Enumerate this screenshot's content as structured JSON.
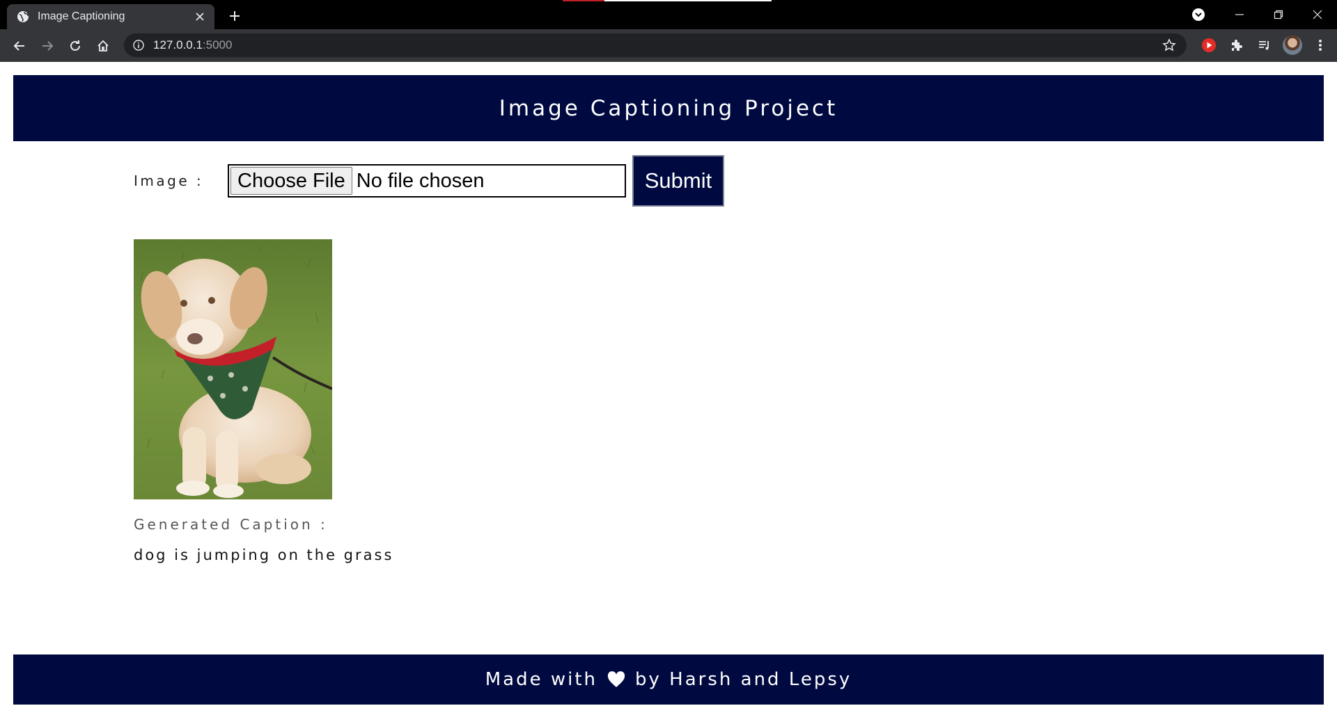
{
  "browser": {
    "tab_title": "Image Captioning",
    "url_host": "127.0.0.1",
    "url_port": ":5000"
  },
  "page": {
    "header_title": "Image Captioning Project",
    "image_label": "Image :",
    "file_button_label": "Choose File",
    "file_status": "No file chosen",
    "submit_label": "Submit",
    "caption_label": "Generated Caption :",
    "caption_text": "dog is jumping on the grass",
    "footer_prefix": "Made with",
    "footer_suffix": "by Harsh and Lepsy"
  },
  "colors": {
    "brand_navy": "#000a40",
    "chrome_dark": "#35363a"
  },
  "icons": [
    "globe-icon",
    "close-icon",
    "plus-icon",
    "back-arrow-icon",
    "forward-arrow-icon",
    "reload-icon",
    "home-icon",
    "info-icon",
    "star-icon",
    "youtube-icon",
    "puzzle-icon",
    "media-queue-icon",
    "kebab-menu-icon",
    "heart-icon"
  ]
}
